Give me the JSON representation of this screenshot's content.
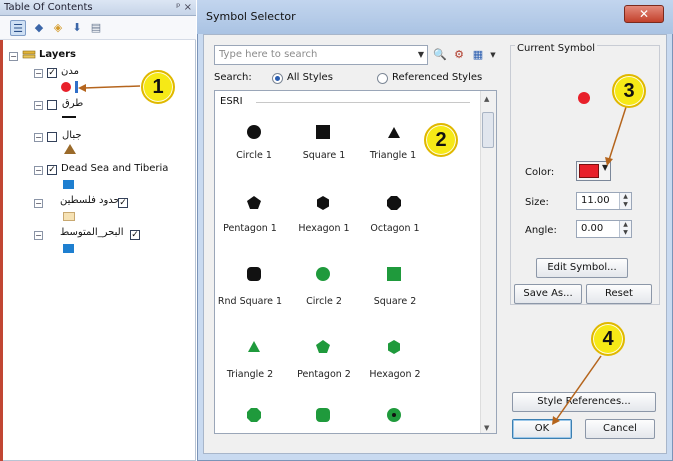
{
  "toc": {
    "title": "Table Of Contents",
    "window_controls": "ᵖ ×",
    "root_label": "Layers",
    "layers": [
      {
        "name": "مدن",
        "checked": true,
        "symbol": "red-circle"
      },
      {
        "name": "طرق",
        "checked": false,
        "symbol": "black-line"
      },
      {
        "name": "جبال",
        "checked": false,
        "symbol": "brown-triangle"
      },
      {
        "name": "Dead Sea and Tiberia",
        "checked": true,
        "symbol": "blue-rect"
      },
      {
        "name": "حدود فلسطين",
        "checked": true,
        "symbol": "beige-rect"
      },
      {
        "name": "البحر_المتوسط",
        "checked": true,
        "symbol": "blue-rect"
      }
    ]
  },
  "dialog": {
    "title": "Symbol Selector",
    "close_symbol": "✕",
    "search_placeholder": "Type here to search",
    "search_label": "Search:",
    "radio_all_styles": "All Styles",
    "radio_referenced_styles": "Referenced Styles",
    "group_header": "ESRI",
    "symbols": [
      {
        "label": "Circle 1"
      },
      {
        "label": "Square 1"
      },
      {
        "label": "Triangle 1"
      },
      {
        "label": "Pentagon 1"
      },
      {
        "label": "Hexagon 1"
      },
      {
        "label": "Octagon 1"
      },
      {
        "label": "Rnd Square 1"
      },
      {
        "label": "Circle 2"
      },
      {
        "label": "Square 2"
      },
      {
        "label": "Triangle 2"
      },
      {
        "label": "Pentagon 2"
      },
      {
        "label": "Hexagon 2"
      },
      {
        "label": ""
      },
      {
        "label": ""
      },
      {
        "label": ""
      }
    ],
    "current_symbol": {
      "group_label": "Current Symbol",
      "color_label": "Color:",
      "color_value": "#e8202a",
      "size_label": "Size:",
      "size_value": "11.00",
      "angle_label": "Angle:",
      "angle_value": "0.00"
    },
    "buttons": {
      "edit_symbol": "Edit Symbol...",
      "save_as": "Save As...",
      "reset": "Reset",
      "style_references": "Style References...",
      "ok": "OK",
      "cancel": "Cancel"
    }
  },
  "callouts": [
    "1",
    "2",
    "3",
    "4"
  ],
  "colors": {
    "callout_fill": "#f6e916",
    "arrow": "#b5651d",
    "symbol_black": "#111111",
    "symbol_green": "#1f9a3c",
    "symbol_red": "#e8202a"
  }
}
